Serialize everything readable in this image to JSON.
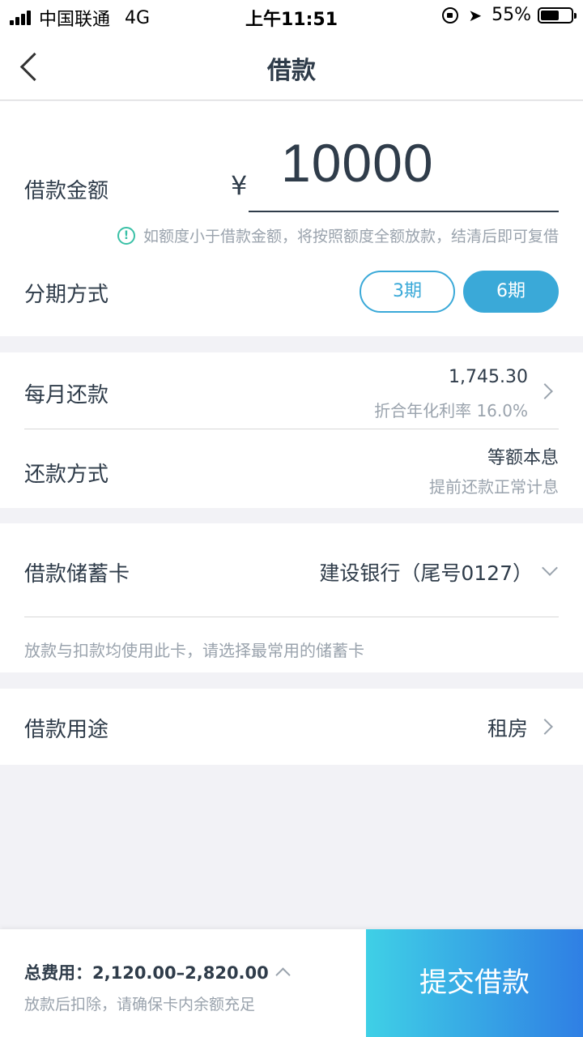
{
  "status_bar": {
    "carrier": "中国联通",
    "network": "4G",
    "time": "上午11:51",
    "battery": "55%"
  },
  "nav": {
    "title": "借款"
  },
  "loan": {
    "amount_label": "借款金额",
    "currency": "¥",
    "amount": "10000",
    "notice": "如额度小于借款金额，将按照额度全额放款，结清后即可复借",
    "installment_label": "分期方式",
    "options": [
      "3期",
      "6期"
    ],
    "selected_index": 1
  },
  "repayment": {
    "monthly_label": "每月还款",
    "monthly_value": "1,745.30",
    "apr_text": "折合年化利率 16.0%",
    "method_label": "还款方式",
    "method_value": "等额本息",
    "method_note": "提前还款正常计息"
  },
  "card": {
    "label": "借款储蓄卡",
    "bank": "建设银行（尾号0127）",
    "note": "放款与扣款均使用此卡，请选择最常用的储蓄卡"
  },
  "purpose": {
    "label": "借款用途",
    "value": "租房"
  },
  "footer": {
    "fee_text": "总费用：2,120.00–2,820.00",
    "fee_note": "放款后扣除，请确保卡内余额充足",
    "submit_label": "提交借款"
  },
  "colors": {
    "accent": "#3aa9d8",
    "submit_gradient_start": "#3fd0e6",
    "submit_gradient_end": "#2f7fe4",
    "text": "#2f3c4a",
    "muted": "#9aa3ad"
  }
}
